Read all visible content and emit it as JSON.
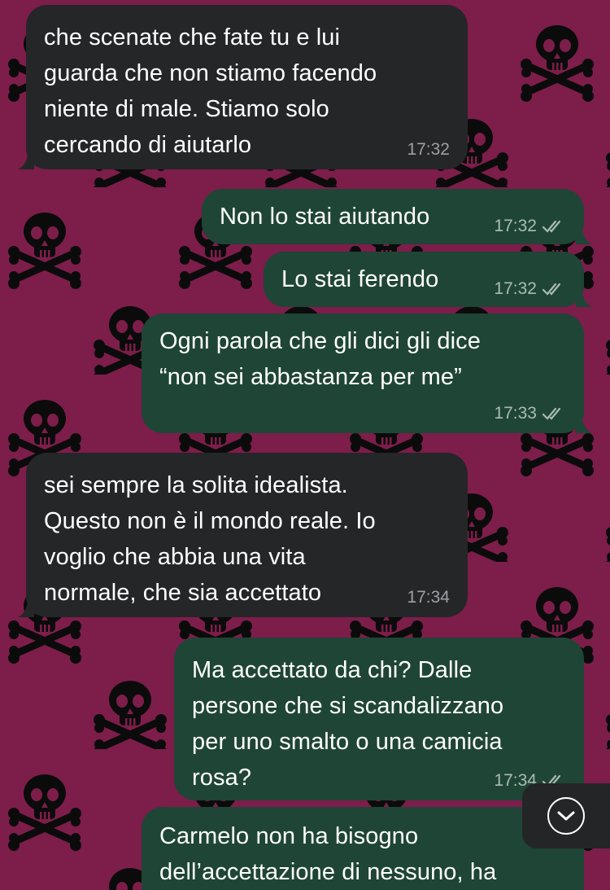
{
  "colors": {
    "wallpaper": "#7d1d4a",
    "incoming_bubble": "#252628",
    "outgoing_bubble": "#1f4536",
    "text": "#ffffff",
    "timestamp": "#9aa0a4"
  },
  "wallpaper": {
    "pattern_icon": "skull-crossbones-icon"
  },
  "messages": [
    {
      "direction": "incoming",
      "text": "che scenate che fate tu e lui\nguarda che non stiamo facendo\nniente di male. Stiamo solo\ncercando di aiutarlo",
      "time": "17:32"
    },
    {
      "direction": "outgoing",
      "text": "Non lo stai aiutando",
      "time": "17:32",
      "status": "read"
    },
    {
      "direction": "outgoing",
      "text": "Lo stai ferendo",
      "time": "17:32",
      "status": "read"
    },
    {
      "direction": "outgoing",
      "text": "Ogni parola che gli dici gli dice\n“non sei abbastanza per me”",
      "time": "17:33",
      "status": "read"
    },
    {
      "direction": "incoming",
      "text": "sei sempre la solita idealista.\nQuesto non è il mondo reale. Io\nvoglio che abbia una vita\nnormale, che sia accettato",
      "time": "17:34"
    },
    {
      "direction": "outgoing",
      "text": "Ma accettato da chi? Dalle\npersone che si scandalizzano\nper uno smalto o una camicia\nrosa?",
      "time": "17:34",
      "status": "read"
    },
    {
      "direction": "outgoing",
      "text": "Carmelo non ha bisogno\ndell’accettazione di nessuno, ha",
      "time": "",
      "status": ""
    }
  ],
  "scroll_button": {
    "icon": "chevron-down-icon"
  }
}
